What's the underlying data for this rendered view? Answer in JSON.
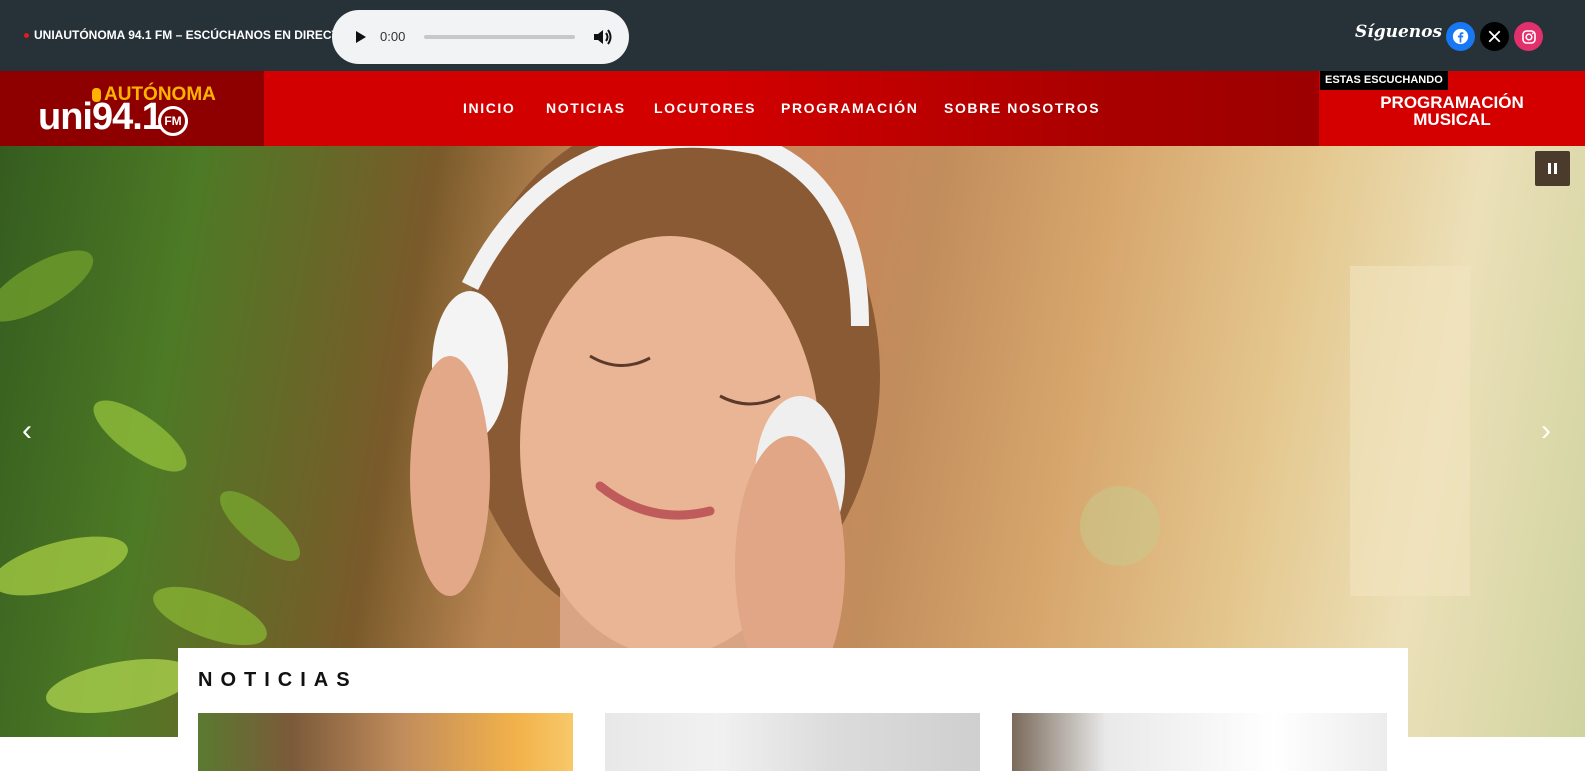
{
  "topbar": {
    "live_text": "UNIAUTÓNOMA 94.1 FM – ESCÚCHANOS EN DIRECTO",
    "player_time": "0:00",
    "follow_label": "Síguenos en",
    "social": [
      "facebook-icon",
      "x-icon",
      "instagram-icon"
    ]
  },
  "logo": {
    "top": "AUTÓNOMA",
    "main": "uni94.1",
    "badge": "FM"
  },
  "nav": {
    "items": [
      "INICIO",
      "NOTICIAS",
      "LOCUTORES",
      "PROGRAMACIÓN",
      "SOBRE NOSOTROS"
    ]
  },
  "now_playing": {
    "label": "ESTAS ESCUCHANDO",
    "title_line1": "PROGRAMACIÓN",
    "title_line2": "MUSICAL"
  },
  "hero": {
    "prev": "‹",
    "next": "›"
  },
  "news": {
    "title": "NOTICIAS"
  },
  "colors": {
    "topbar": "#263238",
    "brand_red": "#d40000",
    "dark_red": "#8e0000",
    "logo_yellow": "#ffb300"
  }
}
